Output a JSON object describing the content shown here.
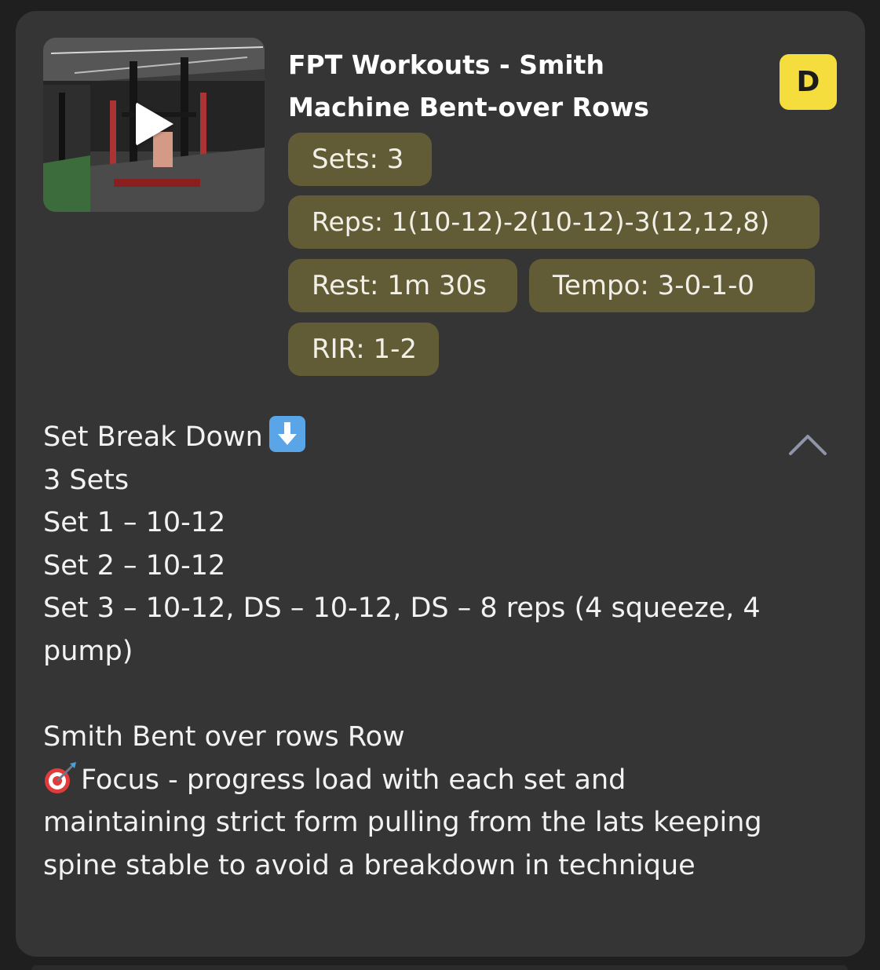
{
  "exercise": {
    "title": "FPT Workouts - Smith Machine Bent-over Rows",
    "grade_badge": "D",
    "video_thumbnail_icon": "play-icon",
    "chips": {
      "sets": "Sets: 3",
      "reps": "Reps: 1(10-12)-2(10-12)-3(12,12,8)",
      "rest": "Rest: 1m 30s",
      "tempo": "Tempo: 3-0-1-0",
      "rir": "RIR: 1-2"
    }
  },
  "description": {
    "heading": "Set Break Down",
    "heading_emoji": "down-arrow-emoji",
    "lines": [
      "3 Sets",
      "Set 1 – 10-12",
      "Set 2 – 10-12",
      "Set 3 – 10-12, DS – 10-12, DS – 8 reps (4 squeeze, 4 pump)"
    ],
    "subheading": "Smith Bent over rows Row",
    "focus_emoji": "target-emoji",
    "focus_text": "Focus - progress load with each set and maintaining strict form pulling from the lats keeping spine stable to avoid a breakdown in technique"
  },
  "controls": {
    "collapse_icon": "chevron-up-icon"
  },
  "colors": {
    "card_background": "#353535",
    "chip_background": "#615b36",
    "badge_yellow": "#f4dd3c",
    "text_primary": "#ffffff"
  }
}
